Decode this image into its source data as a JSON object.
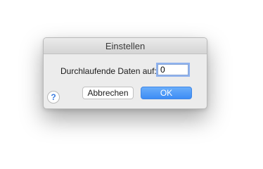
{
  "dialog": {
    "title": "Einstellen",
    "field_label": "Durchlaufende Daten auf:",
    "field_value": "0",
    "help_glyph": "?",
    "cancel_label": "Abbrechen",
    "ok_label": "OK"
  },
  "colors": {
    "accent": "#3d8cf5",
    "dialog_bg": "#ececec",
    "focus_ring": "#8fb2ee"
  },
  "icons": {
    "help": "question-mark-icon"
  }
}
